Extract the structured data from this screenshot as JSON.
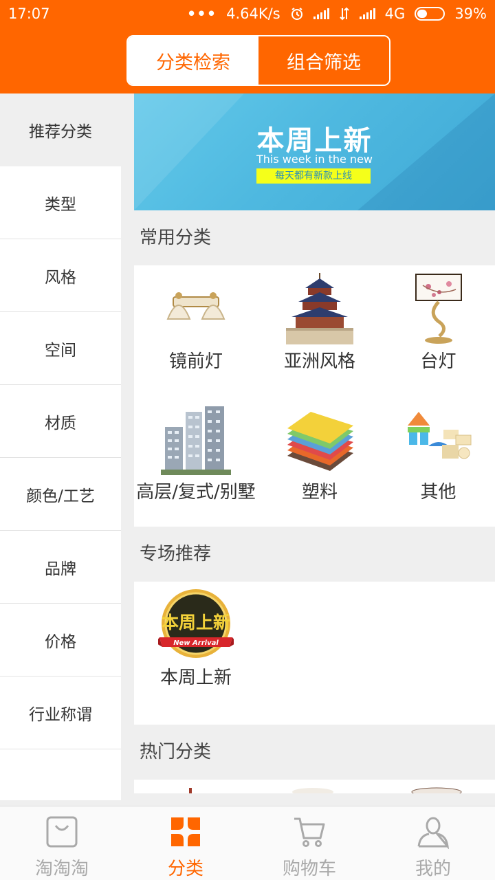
{
  "status": {
    "time": "17:07",
    "dots": "•••",
    "speed": "4.64K/s",
    "network": "4G",
    "battery": "39%"
  },
  "header": {
    "tabs": [
      {
        "label": "分类检索"
      },
      {
        "label": "组合筛选"
      }
    ]
  },
  "sidebar": {
    "items": [
      {
        "label": "推荐分类"
      },
      {
        "label": "类型"
      },
      {
        "label": "风格"
      },
      {
        "label": "空间"
      },
      {
        "label": "材质"
      },
      {
        "label": "颜色/工艺"
      },
      {
        "label": "品牌"
      },
      {
        "label": "价格"
      },
      {
        "label": "行业称谓"
      }
    ]
  },
  "banner": {
    "title": "本周上新",
    "subtitle": "This week in the new",
    "tag": "每天都有新款上线"
  },
  "sections": {
    "common": {
      "title": "常用分类",
      "items": [
        {
          "label": "镜前灯",
          "icon": "mirror-lamp-icon"
        },
        {
          "label": "亚洲风格",
          "icon": "temple-of-heaven-icon"
        },
        {
          "label": "台灯",
          "icon": "table-lamp-icon"
        },
        {
          "label": "高层/复式/别墅",
          "icon": "high-rise-building-icon"
        },
        {
          "label": "塑料",
          "icon": "plastic-boards-icon"
        },
        {
          "label": "其他",
          "icon": "building-blocks-icon"
        }
      ]
    },
    "special": {
      "title": "专场推荐",
      "items": [
        {
          "label": "本周上新",
          "icon": "new-arrival-badge-icon",
          "badge_text": "本周上新",
          "ribbon_text": "New Arrival"
        }
      ]
    },
    "hot": {
      "title": "热门分类"
    }
  },
  "bottom_nav": [
    {
      "label": "淘淘淘",
      "icon": "shopping-bag-icon"
    },
    {
      "label": "分类",
      "icon": "category-grid-icon"
    },
    {
      "label": "购物车",
      "icon": "shopping-cart-icon"
    },
    {
      "label": "我的",
      "icon": "user-profile-icon"
    }
  ],
  "colors": {
    "accent": "#ff6600",
    "background": "#efefef",
    "inactive_nav": "#a9a9a9"
  }
}
